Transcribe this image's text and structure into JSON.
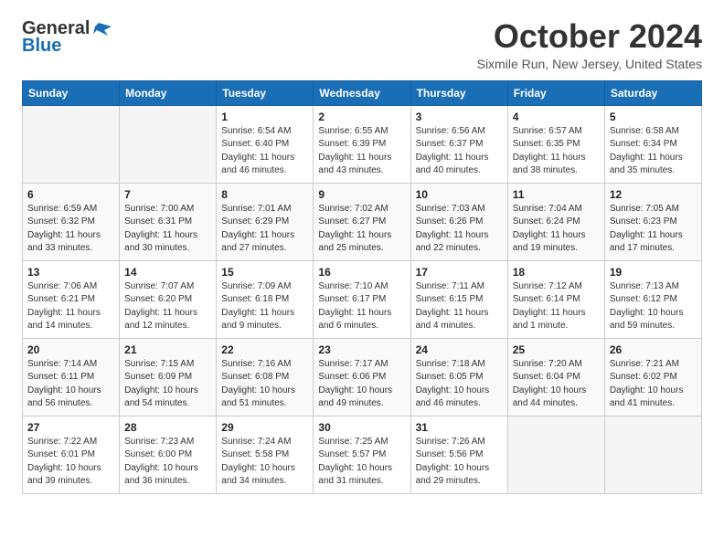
{
  "header": {
    "logo_line1": "General",
    "logo_line2": "Blue",
    "title": "October 2024",
    "subtitle": "Sixmile Run, New Jersey, United States"
  },
  "days_of_week": [
    "Sunday",
    "Monday",
    "Tuesday",
    "Wednesday",
    "Thursday",
    "Friday",
    "Saturday"
  ],
  "weeks": [
    [
      {
        "day": "",
        "info": ""
      },
      {
        "day": "",
        "info": ""
      },
      {
        "day": "1",
        "info": "Sunrise: 6:54 AM\nSunset: 6:40 PM\nDaylight: 11 hours and 46 minutes."
      },
      {
        "day": "2",
        "info": "Sunrise: 6:55 AM\nSunset: 6:39 PM\nDaylight: 11 hours and 43 minutes."
      },
      {
        "day": "3",
        "info": "Sunrise: 6:56 AM\nSunset: 6:37 PM\nDaylight: 11 hours and 40 minutes."
      },
      {
        "day": "4",
        "info": "Sunrise: 6:57 AM\nSunset: 6:35 PM\nDaylight: 11 hours and 38 minutes."
      },
      {
        "day": "5",
        "info": "Sunrise: 6:58 AM\nSunset: 6:34 PM\nDaylight: 11 hours and 35 minutes."
      }
    ],
    [
      {
        "day": "6",
        "info": "Sunrise: 6:59 AM\nSunset: 6:32 PM\nDaylight: 11 hours and 33 minutes."
      },
      {
        "day": "7",
        "info": "Sunrise: 7:00 AM\nSunset: 6:31 PM\nDaylight: 11 hours and 30 minutes."
      },
      {
        "day": "8",
        "info": "Sunrise: 7:01 AM\nSunset: 6:29 PM\nDaylight: 11 hours and 27 minutes."
      },
      {
        "day": "9",
        "info": "Sunrise: 7:02 AM\nSunset: 6:27 PM\nDaylight: 11 hours and 25 minutes."
      },
      {
        "day": "10",
        "info": "Sunrise: 7:03 AM\nSunset: 6:26 PM\nDaylight: 11 hours and 22 minutes."
      },
      {
        "day": "11",
        "info": "Sunrise: 7:04 AM\nSunset: 6:24 PM\nDaylight: 11 hours and 19 minutes."
      },
      {
        "day": "12",
        "info": "Sunrise: 7:05 AM\nSunset: 6:23 PM\nDaylight: 11 hours and 17 minutes."
      }
    ],
    [
      {
        "day": "13",
        "info": "Sunrise: 7:06 AM\nSunset: 6:21 PM\nDaylight: 11 hours and 14 minutes."
      },
      {
        "day": "14",
        "info": "Sunrise: 7:07 AM\nSunset: 6:20 PM\nDaylight: 11 hours and 12 minutes."
      },
      {
        "day": "15",
        "info": "Sunrise: 7:09 AM\nSunset: 6:18 PM\nDaylight: 11 hours and 9 minutes."
      },
      {
        "day": "16",
        "info": "Sunrise: 7:10 AM\nSunset: 6:17 PM\nDaylight: 11 hours and 6 minutes."
      },
      {
        "day": "17",
        "info": "Sunrise: 7:11 AM\nSunset: 6:15 PM\nDaylight: 11 hours and 4 minutes."
      },
      {
        "day": "18",
        "info": "Sunrise: 7:12 AM\nSunset: 6:14 PM\nDaylight: 11 hours and 1 minute."
      },
      {
        "day": "19",
        "info": "Sunrise: 7:13 AM\nSunset: 6:12 PM\nDaylight: 10 hours and 59 minutes."
      }
    ],
    [
      {
        "day": "20",
        "info": "Sunrise: 7:14 AM\nSunset: 6:11 PM\nDaylight: 10 hours and 56 minutes."
      },
      {
        "day": "21",
        "info": "Sunrise: 7:15 AM\nSunset: 6:09 PM\nDaylight: 10 hours and 54 minutes."
      },
      {
        "day": "22",
        "info": "Sunrise: 7:16 AM\nSunset: 6:08 PM\nDaylight: 10 hours and 51 minutes."
      },
      {
        "day": "23",
        "info": "Sunrise: 7:17 AM\nSunset: 6:06 PM\nDaylight: 10 hours and 49 minutes."
      },
      {
        "day": "24",
        "info": "Sunrise: 7:18 AM\nSunset: 6:05 PM\nDaylight: 10 hours and 46 minutes."
      },
      {
        "day": "25",
        "info": "Sunrise: 7:20 AM\nSunset: 6:04 PM\nDaylight: 10 hours and 44 minutes."
      },
      {
        "day": "26",
        "info": "Sunrise: 7:21 AM\nSunset: 6:02 PM\nDaylight: 10 hours and 41 minutes."
      }
    ],
    [
      {
        "day": "27",
        "info": "Sunrise: 7:22 AM\nSunset: 6:01 PM\nDaylight: 10 hours and 39 minutes."
      },
      {
        "day": "28",
        "info": "Sunrise: 7:23 AM\nSunset: 6:00 PM\nDaylight: 10 hours and 36 minutes."
      },
      {
        "day": "29",
        "info": "Sunrise: 7:24 AM\nSunset: 5:58 PM\nDaylight: 10 hours and 34 minutes."
      },
      {
        "day": "30",
        "info": "Sunrise: 7:25 AM\nSunset: 5:57 PM\nDaylight: 10 hours and 31 minutes."
      },
      {
        "day": "31",
        "info": "Sunrise: 7:26 AM\nSunset: 5:56 PM\nDaylight: 10 hours and 29 minutes."
      },
      {
        "day": "",
        "info": ""
      },
      {
        "day": "",
        "info": ""
      }
    ]
  ]
}
